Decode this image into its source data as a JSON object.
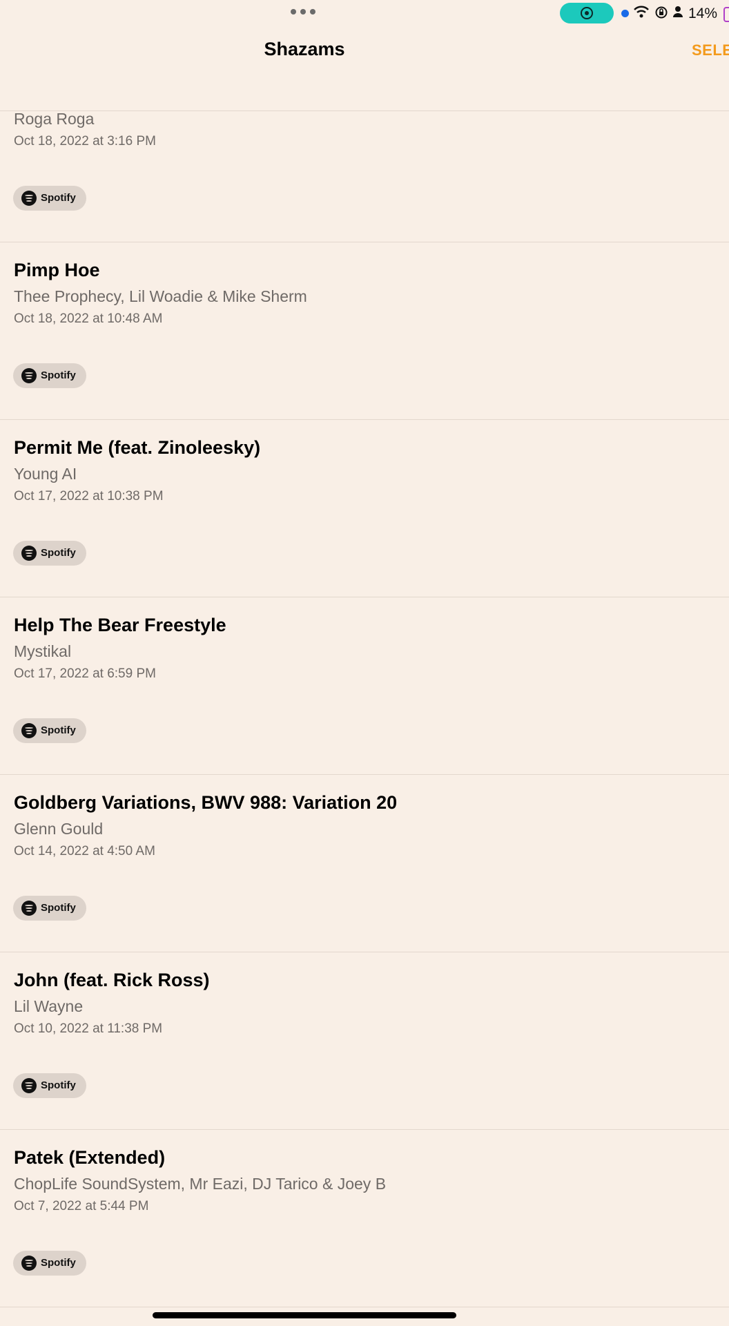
{
  "status_bar": {
    "battery": "14%",
    "icons": [
      "more-dots-icon",
      "screen-record-icon",
      "wifi-icon",
      "lock-rotation-icon",
      "person-icon",
      "battery-icon"
    ]
  },
  "header": {
    "title": "Shazams",
    "select_label": "SELE"
  },
  "rows": [
    {
      "title": "",
      "artist": "Roga Roga",
      "date": "Oct 18, 2022 at 3:16 PM",
      "service": "Spotify"
    },
    {
      "title": "Pimp Hoe",
      "artist": "Thee Prophecy, Lil Woadie & Mike Sherm",
      "date": "Oct 18, 2022 at 10:48 AM",
      "service": "Spotify"
    },
    {
      "title": "Permit Me (feat. Zinoleesky)",
      "artist": "Young AI",
      "date": "Oct 17, 2022 at 10:38 PM",
      "service": "Spotify"
    },
    {
      "title": "Help The Bear Freestyle",
      "artist": "Mystikal",
      "date": "Oct 17, 2022 at 6:59 PM",
      "service": "Spotify"
    },
    {
      "title": "Goldberg Variations, BWV 988: Variation 20",
      "artist": "Glenn Gould",
      "date": "Oct 14, 2022 at 4:50 AM",
      "service": "Spotify"
    },
    {
      "title": "John (feat. Rick Ross)",
      "artist": "Lil Wayne",
      "date": "Oct 10, 2022 at 11:38 PM",
      "service": "Spotify"
    },
    {
      "title": "Patek (Extended)",
      "artist": "ChopLife SoundSystem, Mr Eazi, DJ Tarico & Joey B",
      "date": "Oct 7, 2022 at 5:44 PM",
      "service": "Spotify"
    }
  ],
  "colors": {
    "background": "#f9efe6",
    "accent": "#f39a1c",
    "secondary_text": "#6f6a67",
    "spotify_pill": "#ddd3cb"
  }
}
